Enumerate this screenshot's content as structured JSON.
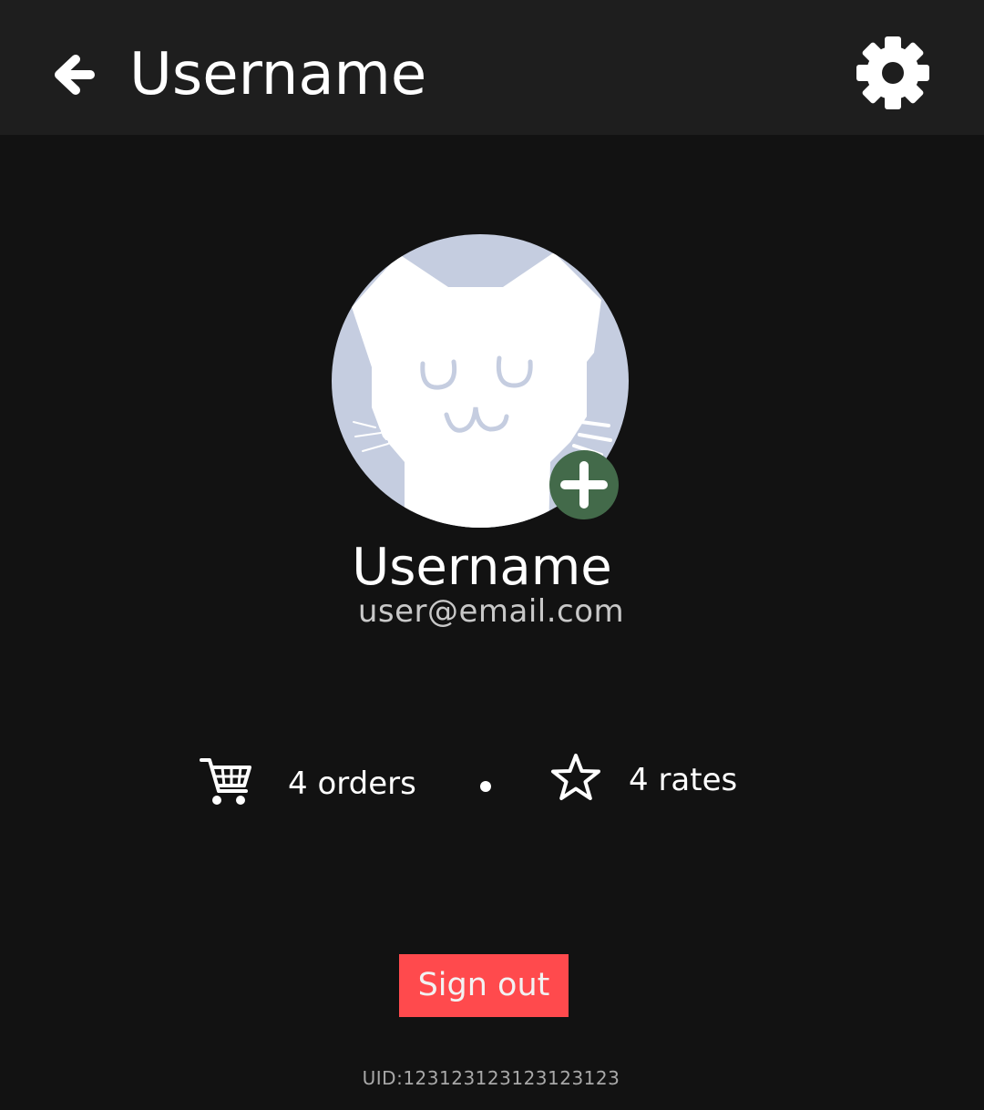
{
  "header": {
    "back_icon": "arrow-left-icon",
    "title": "Username",
    "settings_icon": "gear-icon"
  },
  "profile": {
    "avatar_icon": "cat-face-avatar",
    "add_photo_icon": "plus-circle-icon",
    "name": "Username",
    "email": "user@email.com"
  },
  "stats": {
    "orders_icon": "shopping-cart-icon",
    "orders_label": "4 orders",
    "separator": "bullet",
    "rates_icon": "star-outline-icon",
    "rates_label": "4 rates"
  },
  "actions": {
    "sign_out_label": "Sign out"
  },
  "footer": {
    "uid": "UID:123123123123123123"
  },
  "colors": {
    "background": "#121212",
    "topbar": "#1e1e1e",
    "avatar_bg": "#c5cde0",
    "add_badge": "#436a4a",
    "sign_out": "#ff4a4d",
    "email_text": "#c8c8c8",
    "uid_text": "#a8a8a8"
  }
}
